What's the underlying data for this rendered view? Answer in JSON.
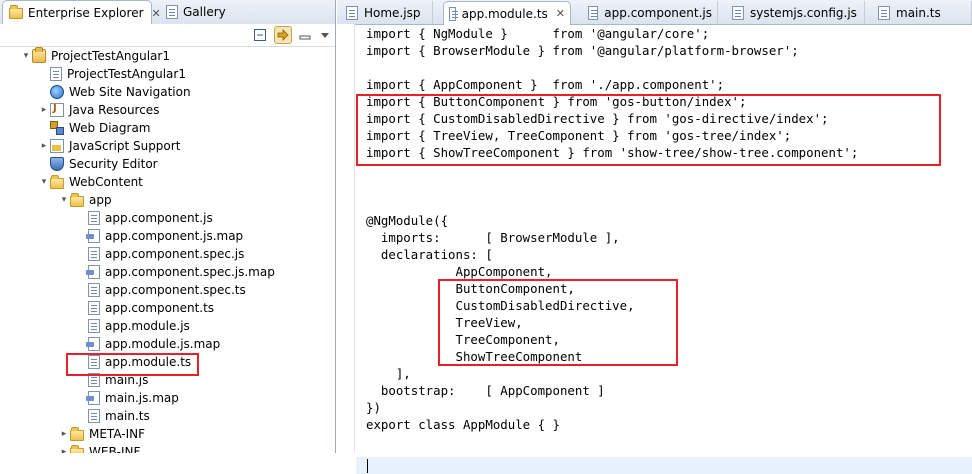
{
  "left_panel": {
    "tabs": [
      {
        "label": "Enterprise Explorer",
        "close": "✕",
        "active": true
      },
      {
        "label": "Gallery",
        "active": false
      }
    ],
    "toolbar_icons": [
      "collapse-all-icon",
      "link-with-editor-icon",
      "view-menu-icon"
    ],
    "tree": [
      {
        "label": "ProjectTestAngular1",
        "icon": "project",
        "depth": 0,
        "twisty": "▾"
      },
      {
        "label": "ProjectTestAngular1",
        "icon": "file",
        "depth": 1,
        "twisty": ""
      },
      {
        "label": "Web Site Navigation",
        "icon": "globe",
        "depth": 1,
        "twisty": ""
      },
      {
        "label": "Java Resources",
        "icon": "java",
        "depth": 1,
        "twisty": "▸"
      },
      {
        "label": "Web Diagram",
        "icon": "diagram",
        "depth": 1,
        "twisty": ""
      },
      {
        "label": "JavaScript Support",
        "icon": "js",
        "depth": 1,
        "twisty": "▸"
      },
      {
        "label": "Security Editor",
        "icon": "shield",
        "depth": 1,
        "twisty": ""
      },
      {
        "label": "WebContent",
        "icon": "folder",
        "depth": 1,
        "twisty": "▾"
      },
      {
        "label": "app",
        "icon": "folder",
        "depth": 2,
        "twisty": "▾"
      },
      {
        "label": "app.component.js",
        "icon": "file",
        "depth": 3,
        "twisty": ""
      },
      {
        "label": "app.component.js.map",
        "icon": "map",
        "depth": 3,
        "twisty": ""
      },
      {
        "label": "app.component.spec.js",
        "icon": "file",
        "depth": 3,
        "twisty": ""
      },
      {
        "label": "app.component.spec.js.map",
        "icon": "map",
        "depth": 3,
        "twisty": ""
      },
      {
        "label": "app.component.spec.ts",
        "icon": "file",
        "depth": 3,
        "twisty": ""
      },
      {
        "label": "app.component.ts",
        "icon": "file",
        "depth": 3,
        "twisty": ""
      },
      {
        "label": "app.module.js",
        "icon": "file",
        "depth": 3,
        "twisty": ""
      },
      {
        "label": "app.module.js.map",
        "icon": "map",
        "depth": 3,
        "twisty": ""
      },
      {
        "label": "app.module.ts",
        "icon": "file",
        "depth": 3,
        "twisty": "",
        "highlighted": true
      },
      {
        "label": "main.js",
        "icon": "file",
        "depth": 3,
        "twisty": ""
      },
      {
        "label": "main.js.map",
        "icon": "map",
        "depth": 3,
        "twisty": ""
      },
      {
        "label": "main.ts",
        "icon": "file",
        "depth": 3,
        "twisty": ""
      },
      {
        "label": "META-INF",
        "icon": "folder",
        "depth": 2,
        "twisty": "▸"
      },
      {
        "label": "WEB-INF",
        "icon": "folder",
        "depth": 2,
        "twisty": "▸"
      }
    ]
  },
  "editor": {
    "tabs": [
      {
        "label": "Home.jsp",
        "active": false
      },
      {
        "label": "app.module.ts",
        "close": "✕",
        "active": true
      },
      {
        "label": "app.component.js",
        "active": false
      },
      {
        "label": "systemjs.config.js",
        "active": false
      },
      {
        "label": "main.ts",
        "active": false
      }
    ],
    "code_lines": [
      "import { NgModule }      from '@angular/core';",
      "import { BrowserModule } from '@angular/platform-browser';",
      "",
      "import { AppComponent }  from './app.component';",
      "import { ButtonComponent } from 'gos-button/index';",
      "import { CustomDisabledDirective } from 'gos-directive/index';",
      "import { TreeView, TreeComponent } from 'gos-tree/index';",
      "import { ShowTreeComponent } from 'show-tree/show-tree.component';",
      "",
      "",
      "",
      "@NgModule({",
      "  imports:      [ BrowserModule ],",
      "  declarations: [",
      "            AppComponent,",
      "            ButtonComponent,",
      "            CustomDisabledDirective,",
      "            TreeView,",
      "            TreeComponent,",
      "            ShowTreeComponent",
      "    ],",
      "  bootstrap:    [ AppComponent ]",
      "})",
      "export class AppModule { }",
      ""
    ]
  },
  "colors": {
    "highlight": "#e8202a",
    "current_line": "#e8f2fe"
  }
}
